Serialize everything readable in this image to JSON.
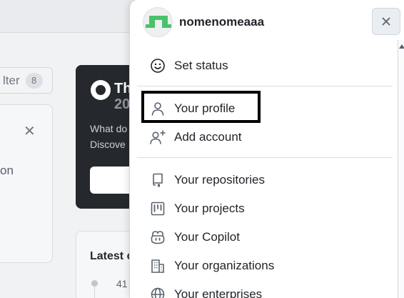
{
  "background": {
    "filter_label": "lter",
    "filter_count": "8",
    "card_fragment": "on",
    "promo": {
      "title_fragment": "Th",
      "year_fragment": "20",
      "line1": "What do",
      "line2": "Discove"
    },
    "latest": {
      "title_fragment": "Latest c",
      "entry_fragment": "41"
    }
  },
  "user_menu": {
    "username": "nomenomeaaa",
    "items": [
      {
        "label": "Set status",
        "icon": "smiley-icon"
      },
      {
        "label": "Your profile",
        "icon": "person-icon"
      },
      {
        "label": "Add account",
        "icon": "person-add-icon"
      },
      {
        "label": "Your repositories",
        "icon": "repo-icon"
      },
      {
        "label": "Your projects",
        "icon": "project-icon"
      },
      {
        "label": "Your Copilot",
        "icon": "copilot-icon"
      },
      {
        "label": "Your organizations",
        "icon": "organization-icon"
      },
      {
        "label": "Your enterprises",
        "icon": "globe-icon"
      }
    ]
  },
  "colors": {
    "panel_bg": "#ffffff",
    "text": "#1f2328",
    "icon": "#59636e",
    "avatar_green": "#4ac26b",
    "highlight_border": "#000000"
  }
}
